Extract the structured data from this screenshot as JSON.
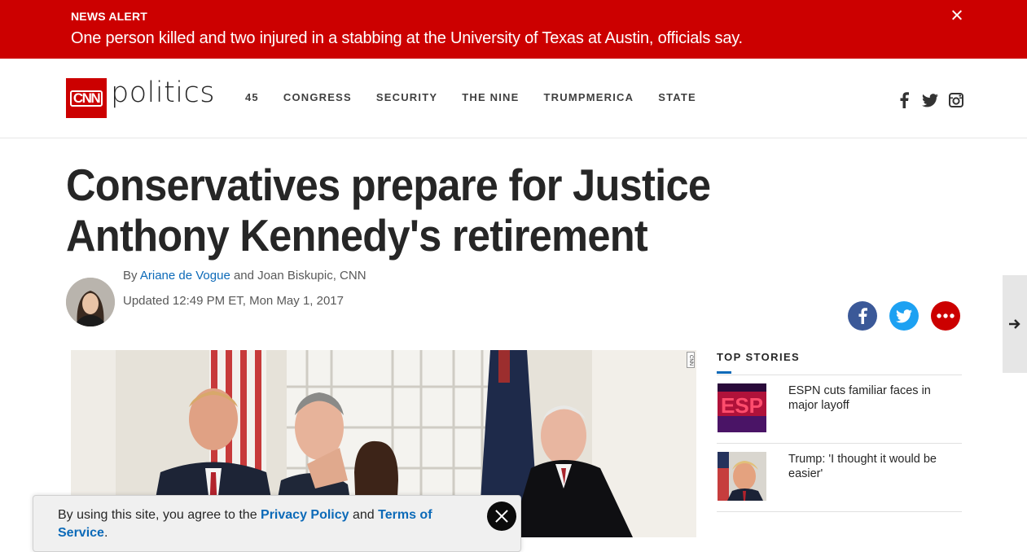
{
  "alert": {
    "kicker": "NEWS ALERT",
    "text": "One person killed and two injured in a stabbing at the University of Texas at Austin, officials say."
  },
  "header": {
    "logo_text": "CNN",
    "section": "politics",
    "nav": [
      "45",
      "CONGRESS",
      "SECURITY",
      "THE NINE",
      "TRUMPMERICA",
      "STATE"
    ],
    "social_icons": [
      "facebook-icon",
      "twitter-icon",
      "instagram-icon"
    ]
  },
  "article": {
    "headline": "Conservatives prepare for Justice Anthony Kennedy's retirement",
    "byline_prefix": "By ",
    "author_link": "Ariane de Vogue",
    "byline_suffix": " and Joan Biskupic, CNN",
    "updated": "Updated 12:49 PM ET, Mon May 1, 2017",
    "media_badge": "CNN"
  },
  "share": {
    "facebook_color": "#3b5998",
    "twitter_color": "#1da1f2",
    "more_color": "#cc0000"
  },
  "top_stories": {
    "title": "TOP STORIES",
    "items": [
      {
        "headline": "ESPN cuts familiar faces in major layoff"
      },
      {
        "headline": "Trump: 'I thought it would be easier'"
      }
    ]
  },
  "cookie": {
    "prefix": "By using this site, you agree to the ",
    "privacy_link": "Privacy Policy",
    "middle": " and ",
    "terms_link": "Terms of Service",
    "suffix": "."
  },
  "colors": {
    "brand_red": "#cc0000",
    "link_blue": "#0c6ab8"
  }
}
